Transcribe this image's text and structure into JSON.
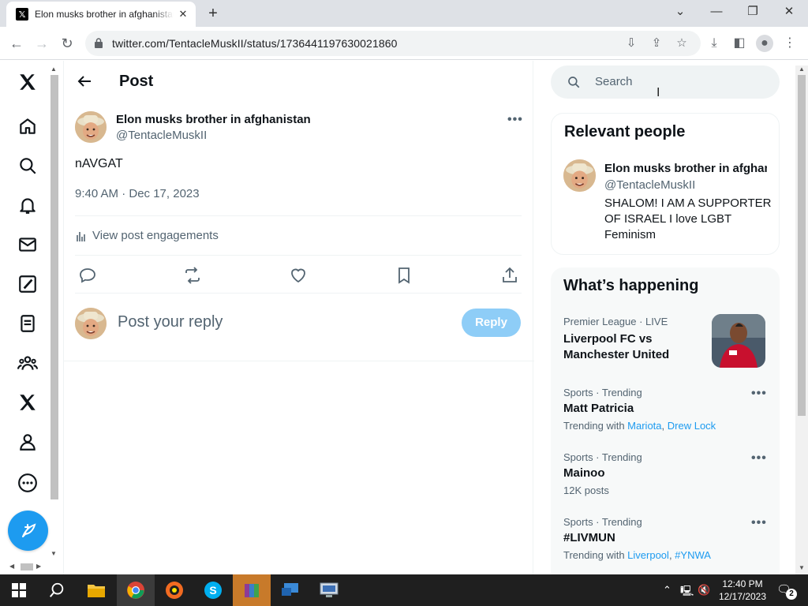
{
  "browser": {
    "tab_title": "Elon musks brother in afghanistan",
    "url": "twitter.com/TentacleMuskII/status/1736441197630021860"
  },
  "leftnav": {
    "items": [
      "home",
      "explore",
      "notifications",
      "messages",
      "grok",
      "lists",
      "communities",
      "premium",
      "profile",
      "more"
    ]
  },
  "post": {
    "header_title": "Post",
    "author_name": "Elon musks brother in afghanistan",
    "author_handle": "@TentacleMuskII",
    "text": "nAVGAT",
    "timestamp": "9:40 AM · Dec 17, 2023",
    "engagements_label": "View post engagements",
    "reply_placeholder": "Post your reply",
    "reply_button": "Reply"
  },
  "sidebar": {
    "search_placeholder": "Search",
    "relevant": {
      "title": "Relevant people",
      "name": "Elon musks brother in afghanistan",
      "handle": "@TentacleMuskII",
      "bio": "SHALOM! I AM A SUPPORTER OF ISRAEL I love LGBT Feminism"
    },
    "happening": {
      "title": "What’s happening",
      "trends": [
        {
          "meta": "Premier League · LIVE",
          "title": "Liverpool FC vs Manchester United"
        },
        {
          "meta": "Sports · Trending",
          "title": "Matt Patricia",
          "sub_prefix": "Trending with ",
          "links": [
            "Mariota",
            "Drew Lock"
          ]
        },
        {
          "meta": "Sports · Trending",
          "title": "Mainoo",
          "sub": "12K posts"
        },
        {
          "meta": "Sports · Trending",
          "title": "#LIVMUN",
          "sub_prefix": "Trending with ",
          "links": [
            "Liverpool",
            "#YNWA"
          ]
        }
      ]
    }
  },
  "taskbar": {
    "time": "12:40 PM",
    "date": "12/17/2023",
    "notifications": "2"
  },
  "colors": {
    "accent": "#1d9bf0",
    "reply_disabled": "#8ecdf7"
  }
}
